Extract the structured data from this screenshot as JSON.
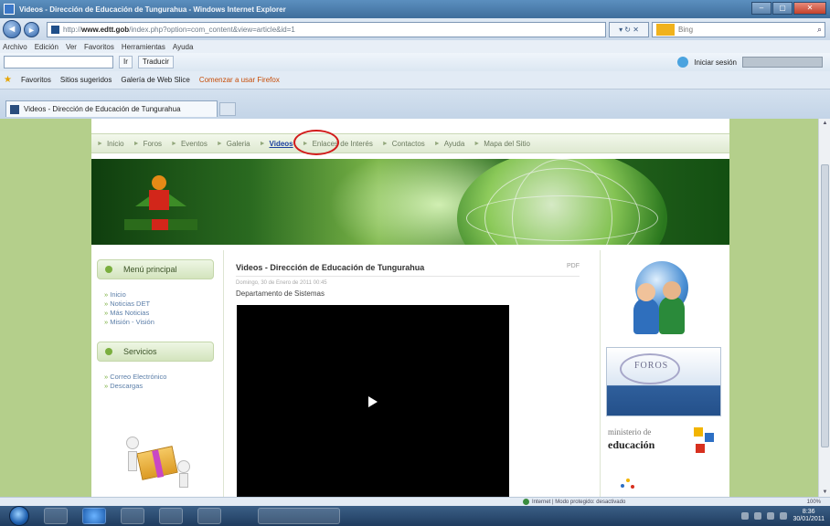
{
  "window": {
    "title": "Videos - Dirección de Educación de Tungurahua - Windows Internet Explorer"
  },
  "browser": {
    "address_domain": "www.edtt.gob",
    "address_path": "/index.php?option=com_content&view=article&id=1",
    "addr_refresh": "▾ ↻ ✕",
    "search_label": "Bing",
    "menu": [
      "Archivo",
      "Edición",
      "Ver",
      "Favoritos",
      "Herramientas",
      "Ayuda"
    ],
    "toolbar": {
      "go_label": "Ir",
      "translate_label": "Traducir",
      "sign_in": "Iniciar sesión"
    },
    "favorites": {
      "label": "Favoritos",
      "items": [
        "Sitios sugeridos",
        "Galería de Web Slice",
        "Comenzar a usar Firefox"
      ]
    },
    "tab_title": "Videos - Dirección de Educación de Tungurahua",
    "status_text": "Internet | Modo protegido: desactivado",
    "zoom": "100%"
  },
  "site": {
    "nav": [
      {
        "label": "Inicio"
      },
      {
        "label": "Foros"
      },
      {
        "label": "Eventos"
      },
      {
        "label": "Galeria"
      },
      {
        "label": "Videos"
      },
      {
        "label": "Enlaces de Interés"
      },
      {
        "label": "Contactos"
      },
      {
        "label": "Ayuda"
      },
      {
        "label": "Mapa del Sitio"
      }
    ],
    "active_nav": "Videos",
    "left": {
      "menu_title": "Menú principal",
      "menu_items": [
        "Inicio",
        "Noticias DET",
        "Más Noticias",
        "Misión - Visión"
      ],
      "services_title": "Servicios",
      "services_items": [
        "Correo Electrónico",
        "Descargas"
      ]
    },
    "article": {
      "title": "Videos - Dirección de Educación de Tungurahua",
      "pdf": "PDF",
      "date": "Domingo, 30 de Enero de 2011 00:45",
      "subtitle": "Departamento de Sistemas"
    },
    "right": {
      "foros_label": "FOROS",
      "ministerio_line1": "ministerio de",
      "ministerio_line2": "educación"
    }
  },
  "taskbar": {
    "clock_time": "8:36",
    "clock_date": "30/01/2011"
  },
  "colors": {
    "page_bg": "#b4cf8b",
    "active_link": "#1a3f9e",
    "highlight_circle": "#d21b1b",
    "banner_green": "#2a6a20"
  }
}
